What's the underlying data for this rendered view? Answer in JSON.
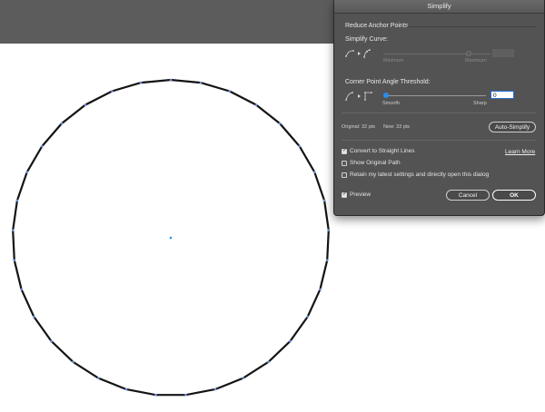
{
  "window": {
    "title": "Simplify"
  },
  "reduce": {
    "heading": "Reduce Anchor Points",
    "curve_label": "Simplify Curve:",
    "min_label": "Minimum",
    "max_label": "Maximum",
    "curve_value": "",
    "curve_level": 0.8
  },
  "angle": {
    "label": "Corner Point Angle Threshold:",
    "smooth_label": "Smooth",
    "sharp_label": "Sharp",
    "value": "0",
    "level": 0.0
  },
  "stats": {
    "original": "Original: 32 pts",
    "new": "New: 33 pts"
  },
  "buttons": {
    "auto_simplify": "Auto-Simplify",
    "cancel": "Cancel",
    "ok": "OK"
  },
  "options": {
    "straight_lines": {
      "label": "Convert to Straight Lines",
      "checked": true
    },
    "show_original": {
      "label": "Show Original Path",
      "checked": false
    },
    "retain": {
      "label": "Retain my latest settings and directly open this dialog",
      "checked": false
    },
    "preview": {
      "label": "Preview",
      "checked": true
    },
    "learn_more": "Learn More"
  },
  "colors": {
    "accent": "#2d8ceb",
    "anchor": "#6f8fe0",
    "path": "#141414",
    "dialog_bg": "#535353",
    "top_bar": "#5c5c5c"
  }
}
